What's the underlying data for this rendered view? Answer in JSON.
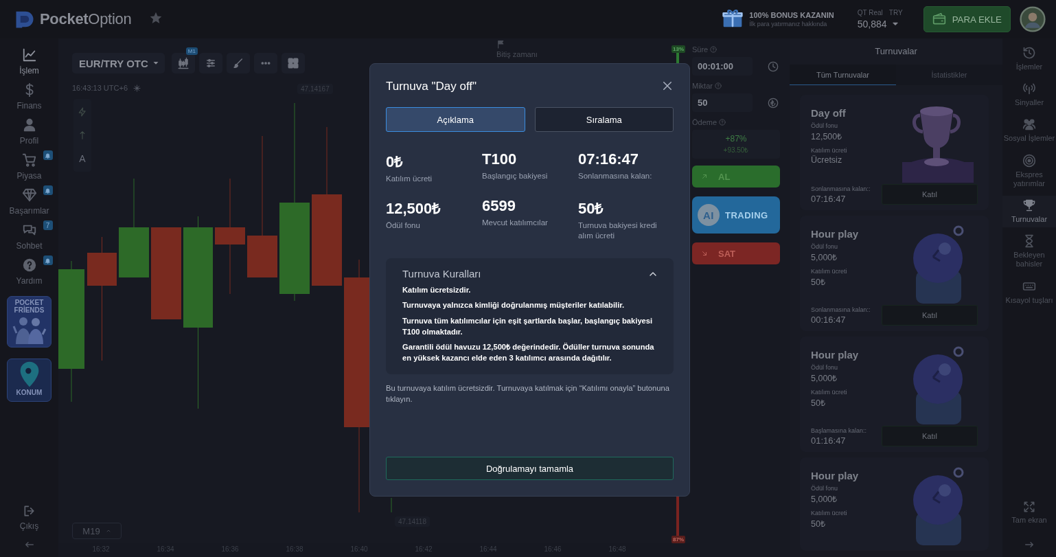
{
  "top_bar": {
    "logo": "**Pocket**Option",
    "bonus": {
      "title": "100% BONUS KAZANIN",
      "subtitle": "İlk para yatırmanız hakkında"
    },
    "account": {
      "type": "QT Real",
      "currency": "TRY",
      "balance": "50,884"
    },
    "deposit_button": "PARA EKLE"
  },
  "left_nav": {
    "items": [
      {
        "label": "İşlem",
        "selected": true
      },
      {
        "label": "Finans",
        "selected": false
      },
      {
        "label": "Profil",
        "selected": false
      },
      {
        "label": "Piyasa",
        "selected": false,
        "badge": {
          "kind": "bell"
        }
      },
      {
        "label": "Başarımlar",
        "selected": false,
        "badge": {
          "kind": "bell"
        }
      },
      {
        "label": "Sohbet",
        "selected": false,
        "badge": {
          "kind": "count",
          "text": "7"
        }
      },
      {
        "label": "Yardım",
        "selected": false,
        "badge": {
          "kind": "bell"
        }
      }
    ],
    "promos": [
      {
        "kind": "friends",
        "label": "POCKET FRİENDS"
      },
      {
        "kind": "location",
        "label": "KONUM"
      }
    ],
    "logout": "Çıkış"
  },
  "chart": {
    "asset": "EUR/TRY OTC",
    "timeframe_badge": "M1",
    "clock": "16:43:13 UTC+6",
    "text_tool": "A",
    "price_labels": [
      "47.14167",
      "47.14118"
    ],
    "expiry_label": "Bitiş zamanı",
    "zoom": "M19",
    "time_ticks": [
      "16:32",
      "16:34",
      "16:36",
      "16:38",
      "16:40",
      "16:42",
      "16:44",
      "16:46",
      "16:48"
    ],
    "sentiment": {
      "up": "13%",
      "down": "87%",
      "level": 0.13
    }
  },
  "trade_panel": {
    "duration": {
      "label": "Süre",
      "value": "00:01:00"
    },
    "amount": {
      "label": "Miktar",
      "value": "50"
    },
    "payout": {
      "label": "Ödeme",
      "percent": "+87%",
      "profit": "+93.50₺"
    },
    "buttons": [
      {
        "kind": "buy",
        "label": "AL"
      },
      {
        "kind": "ai",
        "label": "AI",
        "sublabel": "TRADING"
      },
      {
        "kind": "sell",
        "label": "SAT"
      }
    ]
  },
  "tournaments_panel": {
    "title": "Turnuvalar",
    "tabs": [
      {
        "label": "Tüm Turnuvalar",
        "selected": true
      },
      {
        "label": "İstatistikler",
        "selected": false
      }
    ],
    "cards": [
      {
        "title": "Day off",
        "prize_label": "Ödül fonu",
        "prize": "12,500₺",
        "fee_label": "Katılım ücreti",
        "fee": "Ücretsiz",
        "remaining_label": "Sonlanmasına kalan::",
        "remaining": "07:16:47",
        "button": "Katıl"
      },
      {
        "title": "Hour play",
        "prize_label": "Ödül fonu",
        "prize": "5,000₺",
        "fee_label": "Katılım ücreti",
        "fee": "50₺",
        "remaining_label": "Sonlanmasına kalan::",
        "remaining": "00:16:47",
        "button": "Katıl"
      },
      {
        "title": "Hour play",
        "prize_label": "Ödül fonu",
        "prize": "5,000₺",
        "fee_label": "Katılım ücreti",
        "fee": "50₺",
        "remaining_label": "Başlamasına kalan::",
        "remaining": "01:16:47",
        "button": "Katıl"
      },
      {
        "title": "Hour play",
        "prize_label": "Ödül fonu",
        "prize": "5,000₺",
        "fee_label": "Katılım ücreti",
        "fee": "50₺"
      }
    ]
  },
  "right_nav": {
    "items": [
      {
        "label": "İşlemler",
        "selected": false
      },
      {
        "label": "Sinyaller",
        "selected": false
      },
      {
        "label": "Sosyal İşlemler",
        "selected": false
      },
      {
        "label": "Ekspres yatırımlar",
        "selected": false
      },
      {
        "label": "Turnuvalar",
        "selected": true
      },
      {
        "label": "Bekleyen bahisler",
        "selected": false
      },
      {
        "label": "Kısayol tuşları",
        "selected": false
      }
    ],
    "fullscreen": "Tam ekran"
  },
  "modal": {
    "title": "Turnuva \"Day off\"",
    "tabs": [
      {
        "label": "Açıklama",
        "selected": true
      },
      {
        "label": "Sıralama",
        "selected": false
      }
    ],
    "stats": [
      {
        "value": "0₺",
        "label": "Katılım ücreti"
      },
      {
        "value": "T100",
        "label": "Başlangıç bakiyesi"
      },
      {
        "value": "07:16:47",
        "label": "Sonlanmasına kalan:"
      },
      {
        "value": "12,500₺",
        "label": "Ödül fonu"
      },
      {
        "value": "6599",
        "label": "Mevcut katılımcılar"
      },
      {
        "value": "50₺",
        "label": "Turnuva bakiyesi kredi alım ücreti"
      }
    ],
    "rules": {
      "title": "Turnuva Kuralları",
      "expanded": true,
      "items": [
        "Katılım ücretsizdir.",
        "Turnuvaya yalnızca kimliği doğrulanmış müşteriler katılabilir.",
        "Turnuva tüm katılımcılar için eşit şartlarda başlar, başlangıç bakiyesi T100 olmaktadır.",
        "Garantili ödül havuzu 12,500₺ değerindedir. Ödüller turnuva sonunda en yüksek kazancı elde eden 3 katılımcı arasında dağıtılır."
      ]
    },
    "note": "Bu turnuvaya katılım ücretsizdir. Turnuvaya katılmak için “Katılımı onayla” butonuna tıklayın.",
    "button": "Doğrulamayı tamamla"
  }
}
